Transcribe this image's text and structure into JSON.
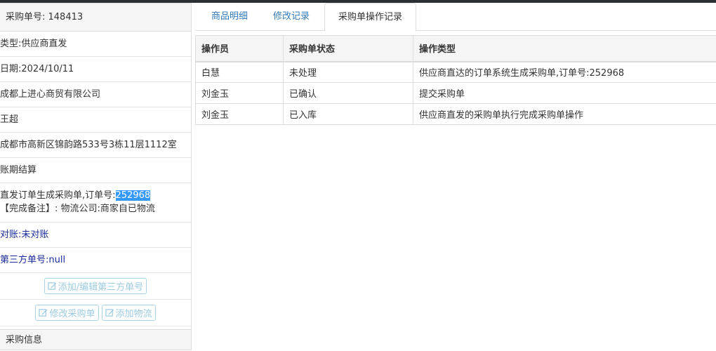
{
  "order": {
    "number_label": "采购单号: 148413",
    "type": "类型:供应商直发",
    "date": "日期:2024/10/11",
    "supplier": "成都上进心商贸有限公司",
    "buyer": "王超",
    "address": "成都市高新区锦韵路533号3栋11层1112室",
    "settlement": "账期结算",
    "remark_prefix": "直发订单生成采购单,订单号:",
    "remark_highlight": "252968",
    "remark_line2": "【完成备注】: 物流公司:商家自已物流",
    "reconcile": "对账:未对账",
    "third_party": "第三方单号:null"
  },
  "actions": {
    "add_edit_third_party": "添加/编辑第三方单号",
    "modify_order": "修改采购单",
    "add_logistics": "添加物流"
  },
  "sub_panel": {
    "title": "采购信息"
  },
  "tabs": [
    {
      "label": "商品明细"
    },
    {
      "label": "修改记录"
    },
    {
      "label": "采购单操作记录"
    }
  ],
  "log_table": {
    "headers": [
      "操作员",
      "采购单状态",
      "操作类型"
    ],
    "rows": [
      [
        "白慧",
        "未处理",
        "供应商直达的订单系统生成采购单,订单号:252968"
      ],
      [
        "刘金玉",
        "已确认",
        "提交采购单"
      ],
      [
        "刘金玉",
        "已入库",
        "供应商直发的采购单执行完成采购单操作"
      ]
    ]
  }
}
